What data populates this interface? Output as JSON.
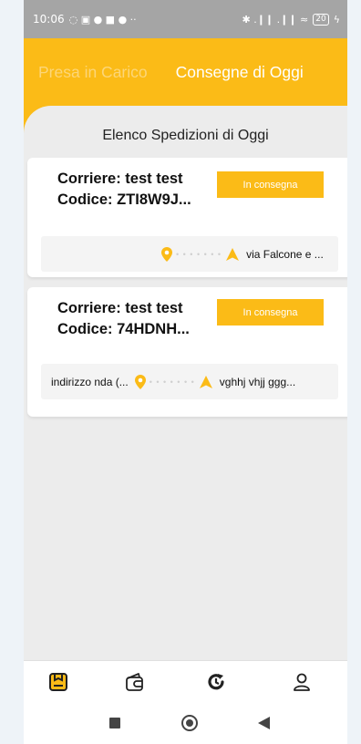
{
  "status_bar": {
    "time": "10:06",
    "left_glyphs": "◌ ▣ ● ■ ● ··",
    "right_glyphs": "✱ .❙❙ .❙❙ ≈",
    "battery": "20",
    "charging": "ϟ"
  },
  "tabs": [
    {
      "label": "Presa in Carico",
      "active": false
    },
    {
      "label": "Consegne di Oggi",
      "active": true
    }
  ],
  "list_title": "Elenco Spedizioni di Oggi",
  "shipments": [
    {
      "courier": "Corriere: test test",
      "code": "Codice: ZTI8W9J...",
      "status": "In consegna",
      "from": "",
      "to": "via Falcone e ..."
    },
    {
      "courier": "Corriere: test test",
      "code": "Codice: 74HDNH...",
      "status": "In consegna",
      "from": "indirizzo nda (...",
      "to": "vghhj vhjj ggg..."
    }
  ],
  "bottom_nav": [
    {
      "icon": "package-icon",
      "active": true
    },
    {
      "icon": "wallet-icon",
      "active": false
    },
    {
      "icon": "history-icon",
      "active": false
    },
    {
      "icon": "profile-icon",
      "active": false
    }
  ],
  "colors": {
    "accent": "#fbbb17",
    "inactive_tab": "#fcd679",
    "background": "#ececec"
  }
}
